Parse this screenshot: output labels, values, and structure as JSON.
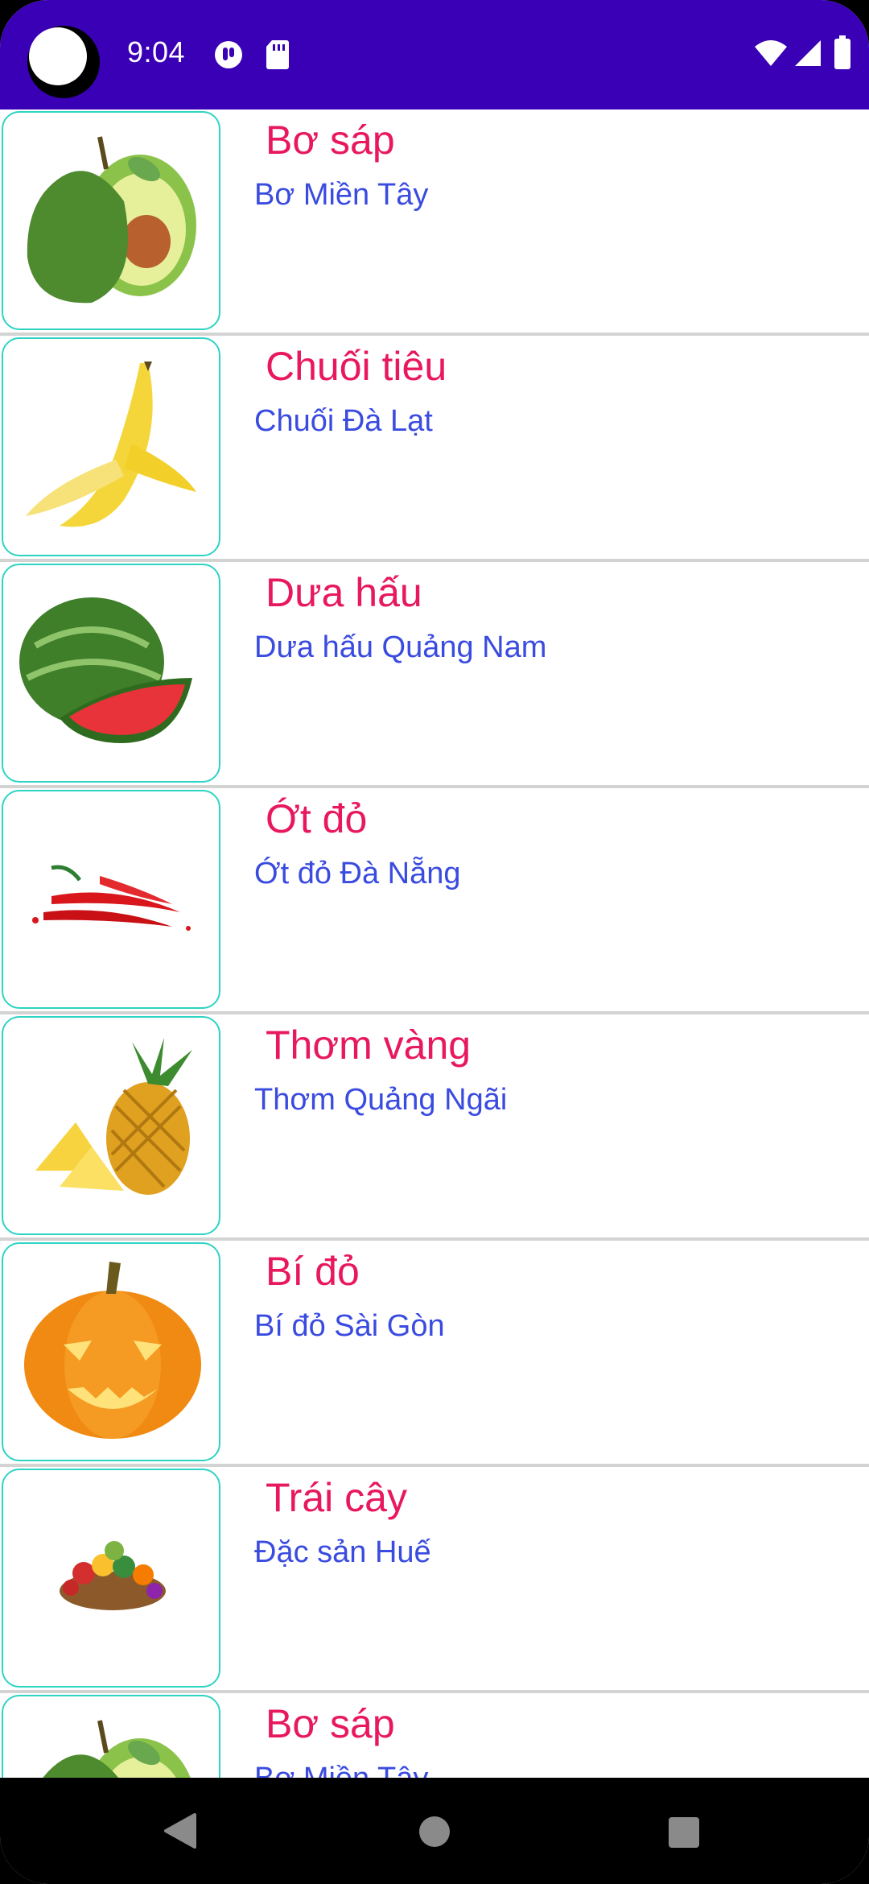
{
  "status_bar": {
    "time": "9:04",
    "icons": [
      "notification-app-icon",
      "sd-card-icon",
      "wifi-icon",
      "signal-icon",
      "battery-icon"
    ],
    "background": "#3a00b6"
  },
  "products": [
    {
      "title": "Bơ sáp",
      "subtitle": "Bơ Miền Tây",
      "image": "avocado"
    },
    {
      "title": "Chuối tiêu",
      "subtitle": "Chuối Đà Lạt",
      "image": "banana"
    },
    {
      "title": "Dưa hấu",
      "subtitle": "Dưa hấu Quảng Nam",
      "image": "watermelon"
    },
    {
      "title": "Ớt đỏ",
      "subtitle": "Ớt đỏ Đà Nẵng",
      "image": "chili"
    },
    {
      "title": "Thơm vàng",
      "subtitle": "Thơm Quảng Ngãi",
      "image": "pineapple"
    },
    {
      "title": "Bí đỏ",
      "subtitle": "Bí đỏ Sài Gòn",
      "image": "pumpkin"
    },
    {
      "title": "Trái cây",
      "subtitle": "Đặc sản Huế",
      "image": "fruit-basket"
    },
    {
      "title": "Bơ sáp",
      "subtitle": "Bơ Miền Tây",
      "image": "avocado"
    }
  ],
  "nav_bar": {
    "buttons": [
      "back-icon",
      "home-icon",
      "recents-icon"
    ]
  },
  "colors": {
    "title": "#e8185e",
    "subtitle": "#3a4be0",
    "thumb_border": "#2dd4c4",
    "divider": "#d3d3d3"
  }
}
